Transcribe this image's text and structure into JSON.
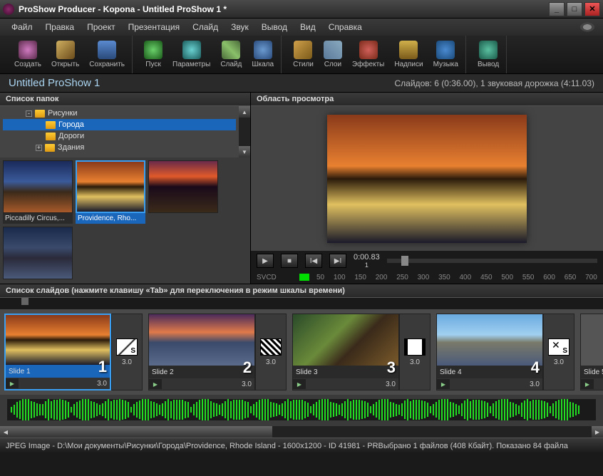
{
  "titlebar": {
    "title": "ProShow Producer - Kopona - Untitled ProShow 1 *"
  },
  "menubar": {
    "items": [
      "Файл",
      "Правка",
      "Проект",
      "Презентация",
      "Слайд",
      "Звук",
      "Вывод",
      "Вид",
      "Справка"
    ]
  },
  "toolbar": {
    "groups": [
      [
        {
          "label": "Создать",
          "icon": "ti-create"
        },
        {
          "label": "Открыть",
          "icon": "ti-open"
        },
        {
          "label": "Сохранить",
          "icon": "ti-save"
        }
      ],
      [
        {
          "label": "Пуск",
          "icon": "ti-play"
        },
        {
          "label": "Параметры",
          "icon": "ti-params"
        },
        {
          "label": "Слайд",
          "icon": "ti-slide"
        },
        {
          "label": "Шкала",
          "icon": "ti-scale"
        }
      ],
      [
        {
          "label": "Стили",
          "icon": "ti-styles"
        },
        {
          "label": "Слои",
          "icon": "ti-layers"
        },
        {
          "label": "Эффекты",
          "icon": "ti-effects"
        },
        {
          "label": "Надписи",
          "icon": "ti-captions"
        },
        {
          "label": "Музыка",
          "icon": "ti-music"
        }
      ],
      [
        {
          "label": "Вывод",
          "icon": "ti-output"
        }
      ]
    ]
  },
  "projectbar": {
    "title": "Untitled ProShow 1",
    "stats": "Слайдов: 6 (0:36.00), 1 звуковая дорожка (4:11.03)"
  },
  "folders": {
    "header": "Список папок",
    "tree": [
      {
        "indent": 28,
        "exp": "-",
        "label": "Рисунки",
        "selected": false
      },
      {
        "indent": 56,
        "exp": "",
        "label": "Города",
        "selected": true
      },
      {
        "indent": 56,
        "exp": "",
        "label": "Дороги",
        "selected": false
      },
      {
        "indent": 42,
        "exp": "+",
        "label": "Здания",
        "selected": false
      }
    ],
    "thumbs": [
      {
        "label": "Piccadilly Circus,...",
        "cls": "g-city1",
        "selected": false
      },
      {
        "label": "Providence, Rho...",
        "cls": "g-city2",
        "selected": true
      },
      {
        "label": "",
        "cls": "g-city3",
        "selected": false
      },
      {
        "label": "",
        "cls": "g-city4",
        "selected": false
      }
    ]
  },
  "preview": {
    "header": "Область просмотра",
    "time": "0:00.83",
    "mark": "1",
    "ruler_label": "SVCD",
    "ruler_ticks": [
      "50",
      "100",
      "150",
      "200",
      "250",
      "300",
      "350",
      "400",
      "450",
      "500",
      "550",
      "600",
      "650",
      "700"
    ]
  },
  "slidelist": {
    "header": "Список слайдов (нажмите клавишу «Tab» для переключения в режим шкалы времени)",
    "slides": [
      {
        "name": "Slide 1",
        "num": "1",
        "dur": "3.0",
        "thumb": "g-city2",
        "trans_dur": "3.0",
        "trans_cls": "trans-s",
        "selected": true
      },
      {
        "name": "Slide 2",
        "num": "2",
        "dur": "3.0",
        "thumb": "g-slide2",
        "trans_dur": "3.0",
        "trans_cls": "trans-qr",
        "selected": false
      },
      {
        "name": "Slide 3",
        "num": "3",
        "dur": "3.0",
        "thumb": "g-slide3",
        "trans_dur": "3.0",
        "trans_cls": "trans-film",
        "selected": false
      },
      {
        "name": "Slide 4",
        "num": "4",
        "dur": "3.0",
        "thumb": "g-slide4",
        "trans_dur": "3.0",
        "trans_cls": "trans-x",
        "selected": false
      },
      {
        "name": "Slide 5",
        "num": "",
        "dur": "",
        "thumb": "",
        "trans_dur": "",
        "trans_cls": "",
        "selected": false
      }
    ]
  },
  "statusbar": {
    "text": "JPEG Image - D:\\Мои документы\\Рисунки\\Города\\Providence, Rhode Island - 1600x1200 - ID 41981 - PRВыбрано 1 файлов (408 Кбайт). Показано 84 файла"
  }
}
